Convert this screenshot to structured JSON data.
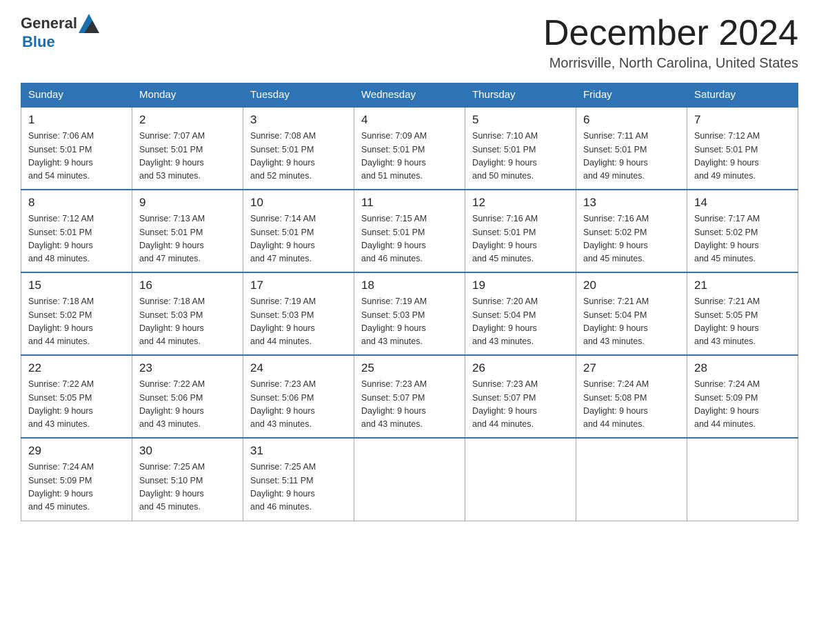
{
  "logo": {
    "general": "General",
    "blue": "Blue"
  },
  "title": {
    "month": "December 2024",
    "location": "Morrisville, North Carolina, United States"
  },
  "headers": [
    "Sunday",
    "Monday",
    "Tuesday",
    "Wednesday",
    "Thursday",
    "Friday",
    "Saturday"
  ],
  "weeks": [
    [
      {
        "day": "1",
        "sunrise": "7:06 AM",
        "sunset": "5:01 PM",
        "daylight": "9 hours and 54 minutes."
      },
      {
        "day": "2",
        "sunrise": "7:07 AM",
        "sunset": "5:01 PM",
        "daylight": "9 hours and 53 minutes."
      },
      {
        "day": "3",
        "sunrise": "7:08 AM",
        "sunset": "5:01 PM",
        "daylight": "9 hours and 52 minutes."
      },
      {
        "day": "4",
        "sunrise": "7:09 AM",
        "sunset": "5:01 PM",
        "daylight": "9 hours and 51 minutes."
      },
      {
        "day": "5",
        "sunrise": "7:10 AM",
        "sunset": "5:01 PM",
        "daylight": "9 hours and 50 minutes."
      },
      {
        "day": "6",
        "sunrise": "7:11 AM",
        "sunset": "5:01 PM",
        "daylight": "9 hours and 49 minutes."
      },
      {
        "day": "7",
        "sunrise": "7:12 AM",
        "sunset": "5:01 PM",
        "daylight": "9 hours and 49 minutes."
      }
    ],
    [
      {
        "day": "8",
        "sunrise": "7:12 AM",
        "sunset": "5:01 PM",
        "daylight": "9 hours and 48 minutes."
      },
      {
        "day": "9",
        "sunrise": "7:13 AM",
        "sunset": "5:01 PM",
        "daylight": "9 hours and 47 minutes."
      },
      {
        "day": "10",
        "sunrise": "7:14 AM",
        "sunset": "5:01 PM",
        "daylight": "9 hours and 47 minutes."
      },
      {
        "day": "11",
        "sunrise": "7:15 AM",
        "sunset": "5:01 PM",
        "daylight": "9 hours and 46 minutes."
      },
      {
        "day": "12",
        "sunrise": "7:16 AM",
        "sunset": "5:01 PM",
        "daylight": "9 hours and 45 minutes."
      },
      {
        "day": "13",
        "sunrise": "7:16 AM",
        "sunset": "5:02 PM",
        "daylight": "9 hours and 45 minutes."
      },
      {
        "day": "14",
        "sunrise": "7:17 AM",
        "sunset": "5:02 PM",
        "daylight": "9 hours and 45 minutes."
      }
    ],
    [
      {
        "day": "15",
        "sunrise": "7:18 AM",
        "sunset": "5:02 PM",
        "daylight": "9 hours and 44 minutes."
      },
      {
        "day": "16",
        "sunrise": "7:18 AM",
        "sunset": "5:03 PM",
        "daylight": "9 hours and 44 minutes."
      },
      {
        "day": "17",
        "sunrise": "7:19 AM",
        "sunset": "5:03 PM",
        "daylight": "9 hours and 44 minutes."
      },
      {
        "day": "18",
        "sunrise": "7:19 AM",
        "sunset": "5:03 PM",
        "daylight": "9 hours and 43 minutes."
      },
      {
        "day": "19",
        "sunrise": "7:20 AM",
        "sunset": "5:04 PM",
        "daylight": "9 hours and 43 minutes."
      },
      {
        "day": "20",
        "sunrise": "7:21 AM",
        "sunset": "5:04 PM",
        "daylight": "9 hours and 43 minutes."
      },
      {
        "day": "21",
        "sunrise": "7:21 AM",
        "sunset": "5:05 PM",
        "daylight": "9 hours and 43 minutes."
      }
    ],
    [
      {
        "day": "22",
        "sunrise": "7:22 AM",
        "sunset": "5:05 PM",
        "daylight": "9 hours and 43 minutes."
      },
      {
        "day": "23",
        "sunrise": "7:22 AM",
        "sunset": "5:06 PM",
        "daylight": "9 hours and 43 minutes."
      },
      {
        "day": "24",
        "sunrise": "7:23 AM",
        "sunset": "5:06 PM",
        "daylight": "9 hours and 43 minutes."
      },
      {
        "day": "25",
        "sunrise": "7:23 AM",
        "sunset": "5:07 PM",
        "daylight": "9 hours and 43 minutes."
      },
      {
        "day": "26",
        "sunrise": "7:23 AM",
        "sunset": "5:07 PM",
        "daylight": "9 hours and 44 minutes."
      },
      {
        "day": "27",
        "sunrise": "7:24 AM",
        "sunset": "5:08 PM",
        "daylight": "9 hours and 44 minutes."
      },
      {
        "day": "28",
        "sunrise": "7:24 AM",
        "sunset": "5:09 PM",
        "daylight": "9 hours and 44 minutes."
      }
    ],
    [
      {
        "day": "29",
        "sunrise": "7:24 AM",
        "sunset": "5:09 PM",
        "daylight": "9 hours and 45 minutes."
      },
      {
        "day": "30",
        "sunrise": "7:25 AM",
        "sunset": "5:10 PM",
        "daylight": "9 hours and 45 minutes."
      },
      {
        "day": "31",
        "sunrise": "7:25 AM",
        "sunset": "5:11 PM",
        "daylight": "9 hours and 46 minutes."
      },
      null,
      null,
      null,
      null
    ]
  ],
  "labels": {
    "sunrise": "Sunrise:",
    "sunset": "Sunset:",
    "daylight": "Daylight:"
  }
}
